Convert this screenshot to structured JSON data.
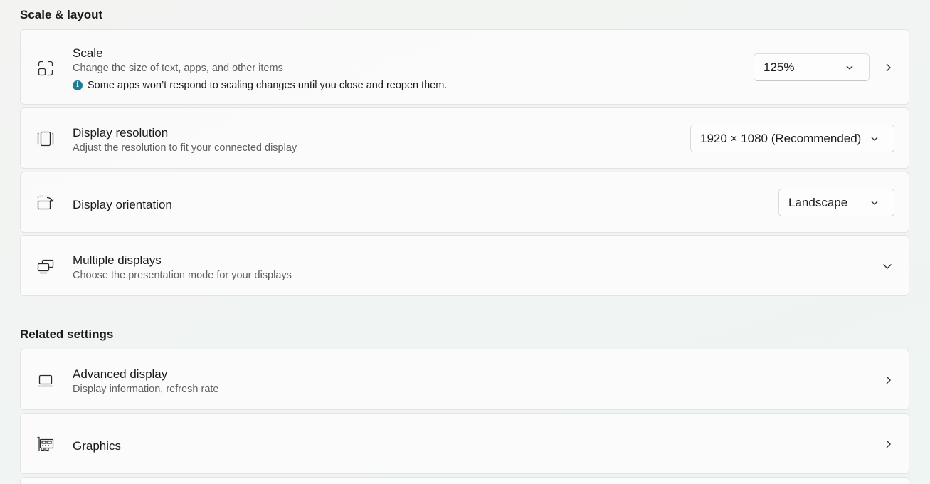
{
  "sections": {
    "scale_layout": "Scale & layout",
    "related": "Related settings"
  },
  "scale": {
    "title": "Scale",
    "subtitle": "Change the size of text, apps, and other items",
    "note_icon": "i",
    "note": "Some apps won’t respond to scaling changes until you close and reopen them.",
    "value": "125%"
  },
  "resolution": {
    "title": "Display resolution",
    "subtitle": "Adjust the resolution to fit your connected display",
    "value": "1920 × 1080 (Recommended)"
  },
  "orientation": {
    "title": "Display orientation",
    "value": "Landscape"
  },
  "multiple": {
    "title": "Multiple displays",
    "subtitle": "Choose the presentation mode for your displays"
  },
  "advanced": {
    "title": "Advanced display",
    "subtitle": "Display information, refresh rate"
  },
  "graphics": {
    "title": "Graphics"
  },
  "icons": {
    "scale": "scale-icon",
    "resolution": "resolution-icon",
    "orientation": "orientation-icon",
    "multiple": "multiple-displays-icon",
    "advanced": "laptop-icon",
    "graphics": "graphics-card-icon"
  },
  "colors": {
    "info_accent": "#1a7f95"
  }
}
